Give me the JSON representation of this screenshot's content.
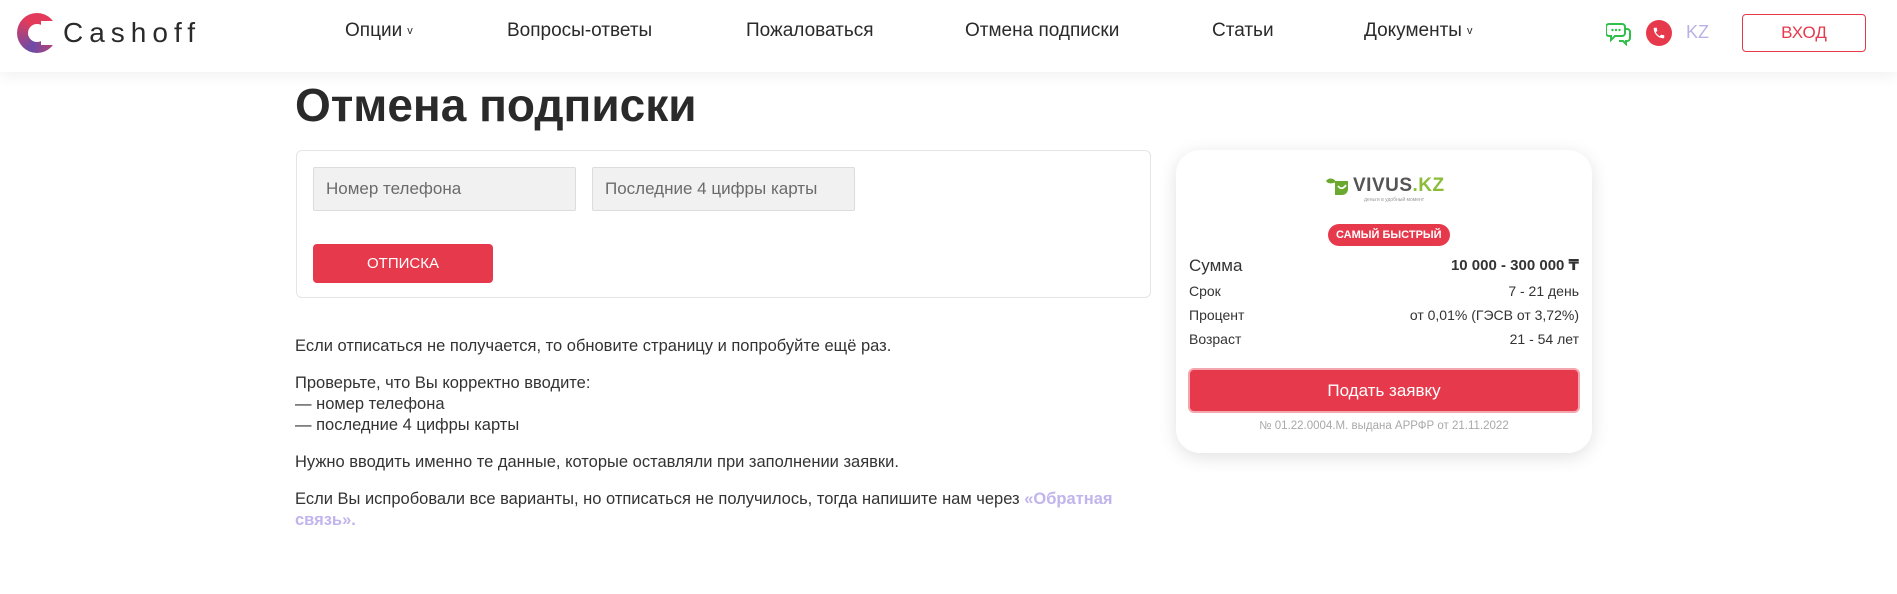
{
  "header": {
    "logo_text": "Cashoff",
    "nav": [
      {
        "label": "Опции",
        "has_dropdown": true
      },
      {
        "label": "Вопросы-ответы",
        "has_dropdown": false
      },
      {
        "label": "Пожаловаться",
        "has_dropdown": false
      },
      {
        "label": "Отмена подписки",
        "has_dropdown": false
      },
      {
        "label": "Статьи",
        "has_dropdown": false
      },
      {
        "label": "Документы",
        "has_dropdown": true
      }
    ],
    "caret": "v",
    "icons": [
      "chat-icon",
      "phone-icon"
    ],
    "lang": "KZ",
    "login_label": "ВХОД"
  },
  "main": {
    "title": "Отмена подписки",
    "form": {
      "phone_placeholder": "Номер телефона",
      "card_placeholder": "Последние 4 цифры карты",
      "submit_label": "ОТПИСКА"
    },
    "info": {
      "p1": "Если отписаться не получается, то обновите страницу и попробуйте ещё раз.",
      "p2_intro": "Проверьте, что Вы корректно вводите:",
      "p2_items": [
        "— номер телефона",
        "— последние 4 цифры карты"
      ],
      "p3": "Нужно вводить именно те данные, которые оставляли при заполнении заявки.",
      "p4_text": "Если Вы испробовали все варианты, но отписаться не получилось, тогда напишите нам через ",
      "p4_link": "«Обратная связь»",
      "p4_end": "."
    }
  },
  "offer": {
    "brand": {
      "name": "VIVUS",
      "suffix": ".KZ",
      "tagline": "деньги в удобный момент"
    },
    "badge": "САМЫЙ БЫСТРЫЙ",
    "rows": [
      {
        "key": "Сумма",
        "value": "10 000 - 300 000 ₸"
      },
      {
        "key": "Срок",
        "value": "7 - 21 день"
      },
      {
        "key": "Процент",
        "value": "от 0,01% (ГЭСВ от 3,72%)"
      },
      {
        "key": "Возраст",
        "value": "21 - 54 лет"
      }
    ],
    "apply_label": "Подать заявку",
    "license": "№ 01.22.0004.M. выдана АРРФР от 21.11.2022"
  },
  "colors": {
    "accent": "#e63a4c",
    "link": "#c2b4ec",
    "lang": "#b9b2e6",
    "chat": "#2fbf4a",
    "brand_green": "#8bbd3a"
  }
}
